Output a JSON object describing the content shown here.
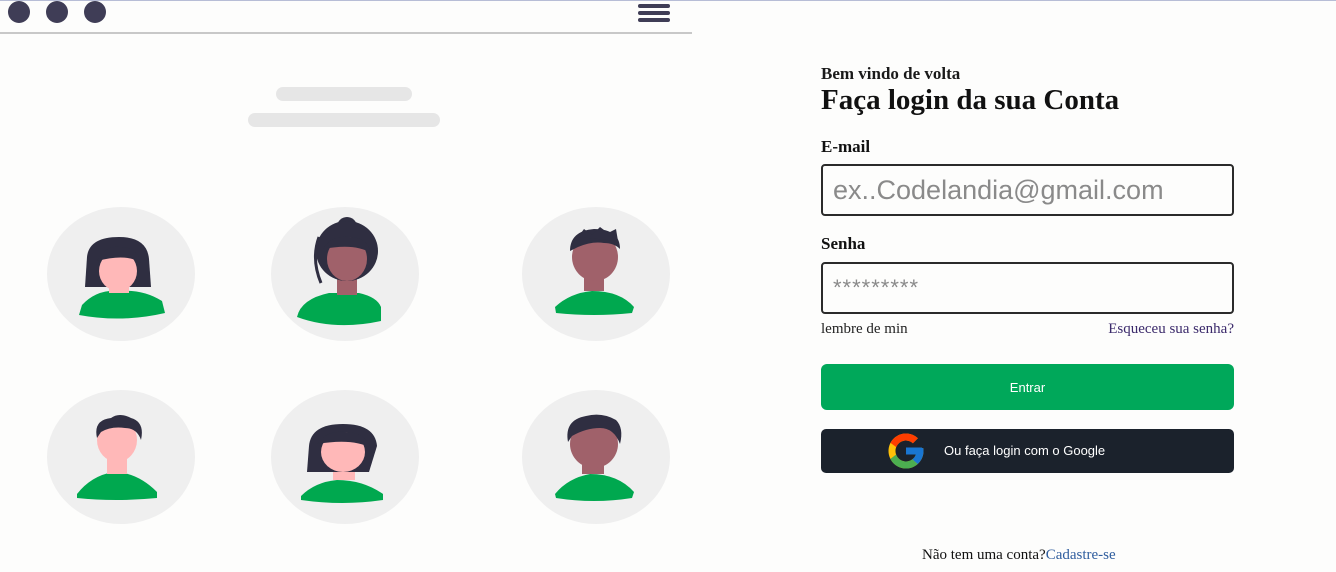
{
  "illustration": {
    "window_dots": 3,
    "avatars": [
      {
        "id": "avatar-1"
      },
      {
        "id": "avatar-2"
      },
      {
        "id": "avatar-3"
      },
      {
        "id": "avatar-4"
      },
      {
        "id": "avatar-5"
      },
      {
        "id": "avatar-6"
      }
    ],
    "colors": {
      "shirt": "#00a84f",
      "hair": "#2f2e41",
      "light_skin": "#ffb8b8",
      "dark_skin": "#a0616a",
      "circle_bg": "#efefef",
      "dot": "#3f3d56"
    }
  },
  "login": {
    "welcome": "Bem vindo de volta",
    "title": "Faça login da sua Conta",
    "email_label": "E-mail",
    "email_placeholder": "ex..Codelandia@gmail.com",
    "password_label": "Senha",
    "password_placeholder": "*********",
    "remember": "lembre de min",
    "forgot": "Esqueceu sua senha?",
    "enter_button": "Entrar",
    "google_button": "Ou faça login com o Google",
    "no_account": "Não tem uma conta?",
    "signup_link": "Cadastre-se"
  },
  "colors": {
    "primary": "#00a85a",
    "google_button_bg": "#1b222c",
    "link": "#2f5d9e"
  }
}
